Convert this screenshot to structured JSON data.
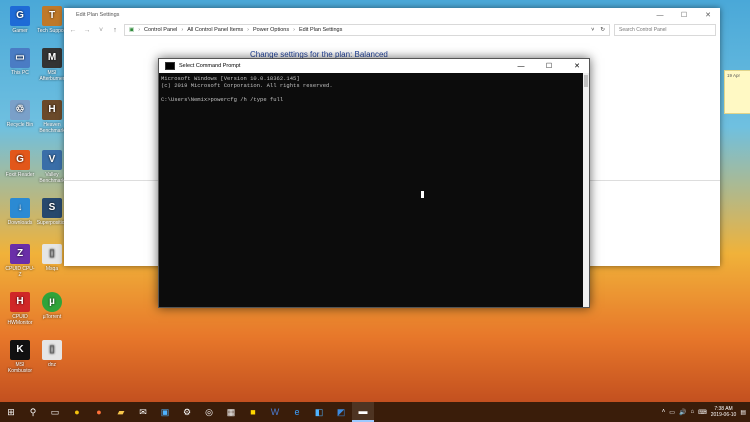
{
  "desktop": {
    "icons": [
      {
        "label": "Gamer",
        "color": "#1e6bd6",
        "glyph": "G"
      },
      {
        "label": "This PC",
        "color": "#4a7cc4",
        "glyph": "▭"
      },
      {
        "label": "Recycle Bin",
        "color": "#7aa0c9",
        "glyph": "♲"
      },
      {
        "label": "Foxit Reader",
        "color": "#e2571a",
        "glyph": "G"
      },
      {
        "label": "Downloads",
        "color": "#2b8ad3",
        "glyph": "↓"
      },
      {
        "label": "CPUID CPU-Z",
        "color": "#6a2ea8",
        "glyph": "Z"
      },
      {
        "label": "CPUID HWMonitor",
        "color": "#d02727",
        "glyph": "H"
      },
      {
        "label": "MSI Kombustor",
        "color": "#111111",
        "glyph": "K"
      }
    ],
    "icons_col2": [
      {
        "label": "Tech Support",
        "color": "#c0792a",
        "glyph": "T"
      },
      {
        "label": "MSI Afterburner",
        "color": "#333333",
        "glyph": "M"
      },
      {
        "label": "Heaven Benchmark",
        "color": "#6b4a2a",
        "glyph": "H"
      },
      {
        "label": "Valley Benchmark",
        "color": "#3a6ea8",
        "glyph": "V"
      },
      {
        "label": "Superposition",
        "color": "#27486d",
        "glyph": "S"
      },
      {
        "label": "Msqa",
        "color": "#e5e5e5",
        "glyph": "▯"
      },
      {
        "label": "µTorrent",
        "color": "#2fa33a",
        "glyph": "µ"
      },
      {
        "label": "dnz",
        "color": "#e5e5e5",
        "glyph": "▯"
      }
    ]
  },
  "explorer": {
    "title": "Edit Plan Settings",
    "breadcrumb": [
      "Control Panel",
      "All Control Panel Items",
      "Power Options",
      "Edit Plan Settings"
    ],
    "search_placeholder": "Search Control Panel",
    "heading": "Change settings for the plan: Balanced",
    "note_text": "19 Apr"
  },
  "cmd": {
    "title": "Select Command Prompt",
    "lines": "Microsoft Windows [Version 10.0.18362.145]\n(c) 2019 Microsoft Corporation. All rights reserved.\n\nC:\\Users\\Nemix>powercfg /h /type full"
  },
  "taskbar": {
    "time": "7:38 AM",
    "date": "2019-06-10",
    "apps": [
      "start-icon",
      "search-icon",
      "task-view-icon",
      "chrome-icon",
      "firefox-icon",
      "folder-icon",
      "mail-icon",
      "store-icon",
      "settings-icon",
      "network-icon",
      "calculator-icon",
      "sticky-notes-icon",
      "word-icon",
      "edge-icon",
      "photos-icon",
      "outlook-icon",
      "cmd-icon"
    ]
  }
}
